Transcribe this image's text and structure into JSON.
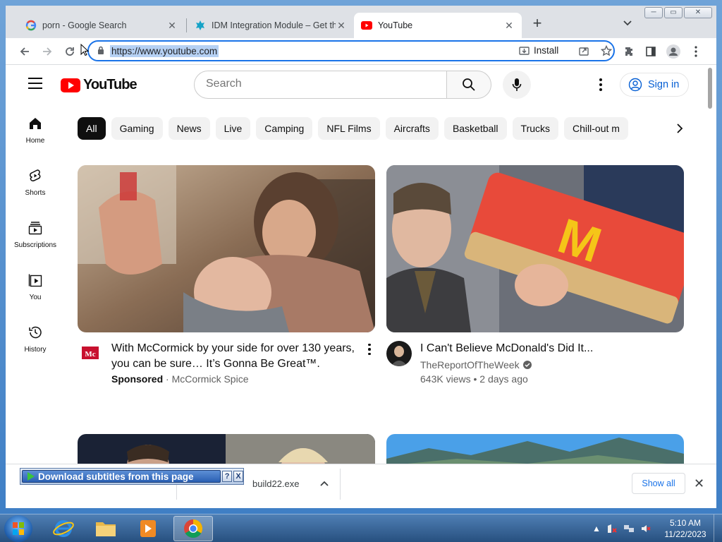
{
  "browser": {
    "tabs": [
      {
        "title": "porn - Google Search",
        "favicon": "google-icon"
      },
      {
        "title": "IDM Integration Module – Get th",
        "favicon": "idm-icon"
      },
      {
        "title": "YouTube",
        "favicon": "youtube-icon"
      }
    ],
    "url": "https://www.youtube.com",
    "install_label": "Install"
  },
  "youtube": {
    "logo_text": "YouTube",
    "search_placeholder": "Search",
    "sign_in": "Sign in",
    "nav": [
      "Home",
      "Shorts",
      "Subscriptions",
      "You",
      "History"
    ],
    "chips": [
      "All",
      "Gaming",
      "News",
      "Live",
      "Camping",
      "NFL Films",
      "Aircrafts",
      "Basketball",
      "Trucks",
      "Chill-out m"
    ],
    "videos": [
      {
        "title": "With McCormick by your side for over 130 years, you can be sure… It’s Gonna Be Great™.",
        "sponsored": "Sponsored",
        "channel": "McCormick Spice",
        "avatar_text": "Mc"
      },
      {
        "title": "I Can't Believe McDonald's Did It...",
        "channel": "TheReportOfTheWeek",
        "stats": "643K views • 2 days ago",
        "verified": true
      }
    ]
  },
  "downloads": {
    "file": "build22.exe",
    "show_all": "Show all",
    "idm_label": "Download subtitles from this page",
    "idm_help": "?",
    "idm_close": "X"
  },
  "taskbar": {
    "time": "5:10 AM",
    "date": "11/22/2023"
  },
  "colors": {
    "youtube_red": "#ff0000",
    "accent": "#1a73e8",
    "chip_bg": "#f2f2f2"
  }
}
